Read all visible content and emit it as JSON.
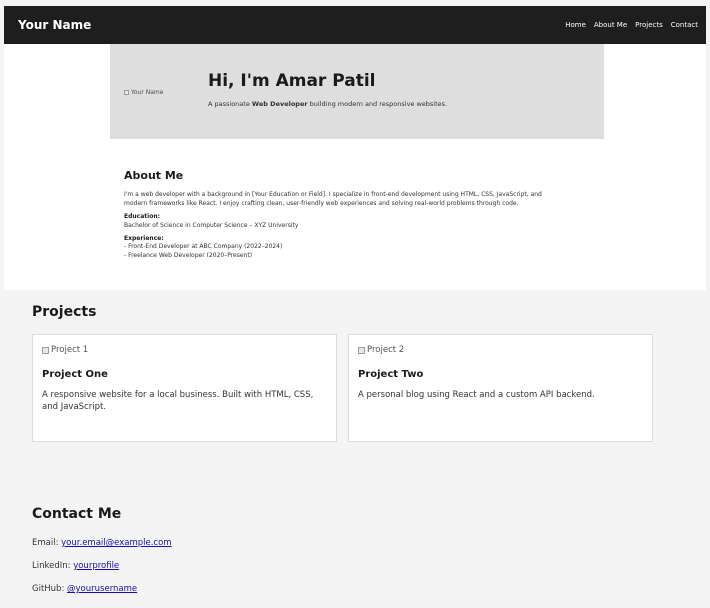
{
  "navbar": {
    "brand": "Your Name",
    "links": [
      "Home",
      "About Me",
      "Projects",
      "Contact"
    ]
  },
  "hero": {
    "image_alt": "Your Name",
    "title": "Hi, I'm Amar Patil",
    "subtitle_prefix": "A passionate ",
    "subtitle_bold": "Web Developer",
    "subtitle_suffix": " building modern and responsive websites."
  },
  "about": {
    "heading": "About Me",
    "intro_line1": "I'm a web developer with a background in [Your Education or Field]. I specialize in front-end development using HTML, CSS, JavaScript, and",
    "intro_line2": "modern frameworks like React. I enjoy crafting clean, user-friendly web experiences and solving real-world problems through code.",
    "education_label": "Education:",
    "education_value": "Bachelor of Science in Computer Science – XYZ University",
    "experience_label": "Experience:",
    "experience_items": [
      "- Front-End Developer at ABC Company (2022–2024)",
      "- Freelance Web Developer (2020–Present)"
    ]
  },
  "projects": {
    "heading": "Projects",
    "items": [
      {
        "image_alt": "Project 1",
        "title": "Project One",
        "description": "A responsive website for a local business. Built with HTML, CSS, and JavaScript."
      },
      {
        "image_alt": "Project 2",
        "title": "Project Two",
        "description": "A personal blog using React and a custom API backend."
      }
    ]
  },
  "contact": {
    "heading": "Contact Me",
    "email_label": "Email: ",
    "email_value": "your.email@example.com",
    "linkedin_label": "LinkedIn: ",
    "linkedin_value": "yourprofile",
    "github_label": "GitHub: ",
    "github_value": "@yourusername"
  },
  "colors": {
    "navbar_bg": "#1e1e1e",
    "hero_bg": "#dedede",
    "link": "#1a0dab"
  }
}
